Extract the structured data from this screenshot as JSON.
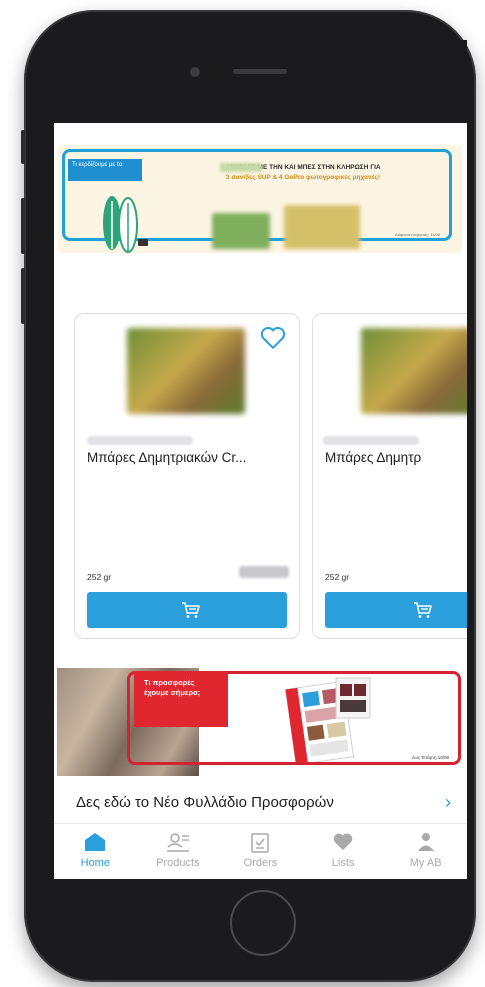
{
  "banner_promo": {
    "tag_text": "Τι κερδίζουμε με τα",
    "headline": "ΑΓΟΡΑΣΕ ΜΕ ΤΗΝ ΚΑΙ ΜΠΕΣ ΣΤΗΝ ΚΛΗΡΩΣΗ ΓΙΑ",
    "subline": "3 σανίδες SUP & 4 GoPro φωτογραφικές μηχανές!",
    "footnote": "Διάρκεια ενέργειας: 11/08"
  },
  "products": [
    {
      "name": "Μπάρες Δημητριακών Cr...",
      "weight": "252 gr",
      "favorite_icon": "heart-outline"
    },
    {
      "name": "Μπάρες Δημητρ",
      "weight": "252 gr"
    }
  ],
  "banner_leaflet": {
    "tag_text": "Τι προσφορές έχουμε σήμερα;",
    "footnote": "έως Τετάρτη 10/08"
  },
  "leaflet_link": {
    "label": "Δες εδώ το Νέο Φυλλάδιο Προσφορών",
    "chevron": "›"
  },
  "tabs": [
    {
      "label": "Home",
      "icon": "home-icon",
      "active": true
    },
    {
      "label": "Products",
      "icon": "products-icon",
      "active": false
    },
    {
      "label": "Orders",
      "icon": "orders-icon",
      "active": false
    },
    {
      "label": "Lists",
      "icon": "heart-icon",
      "active": false
    },
    {
      "label": "My AB",
      "icon": "user-icon",
      "active": false
    }
  ],
  "colors": {
    "accent": "#2a9fdc",
    "promo_red": "#e0262e",
    "inactive_tab": "#a9a9a9"
  }
}
